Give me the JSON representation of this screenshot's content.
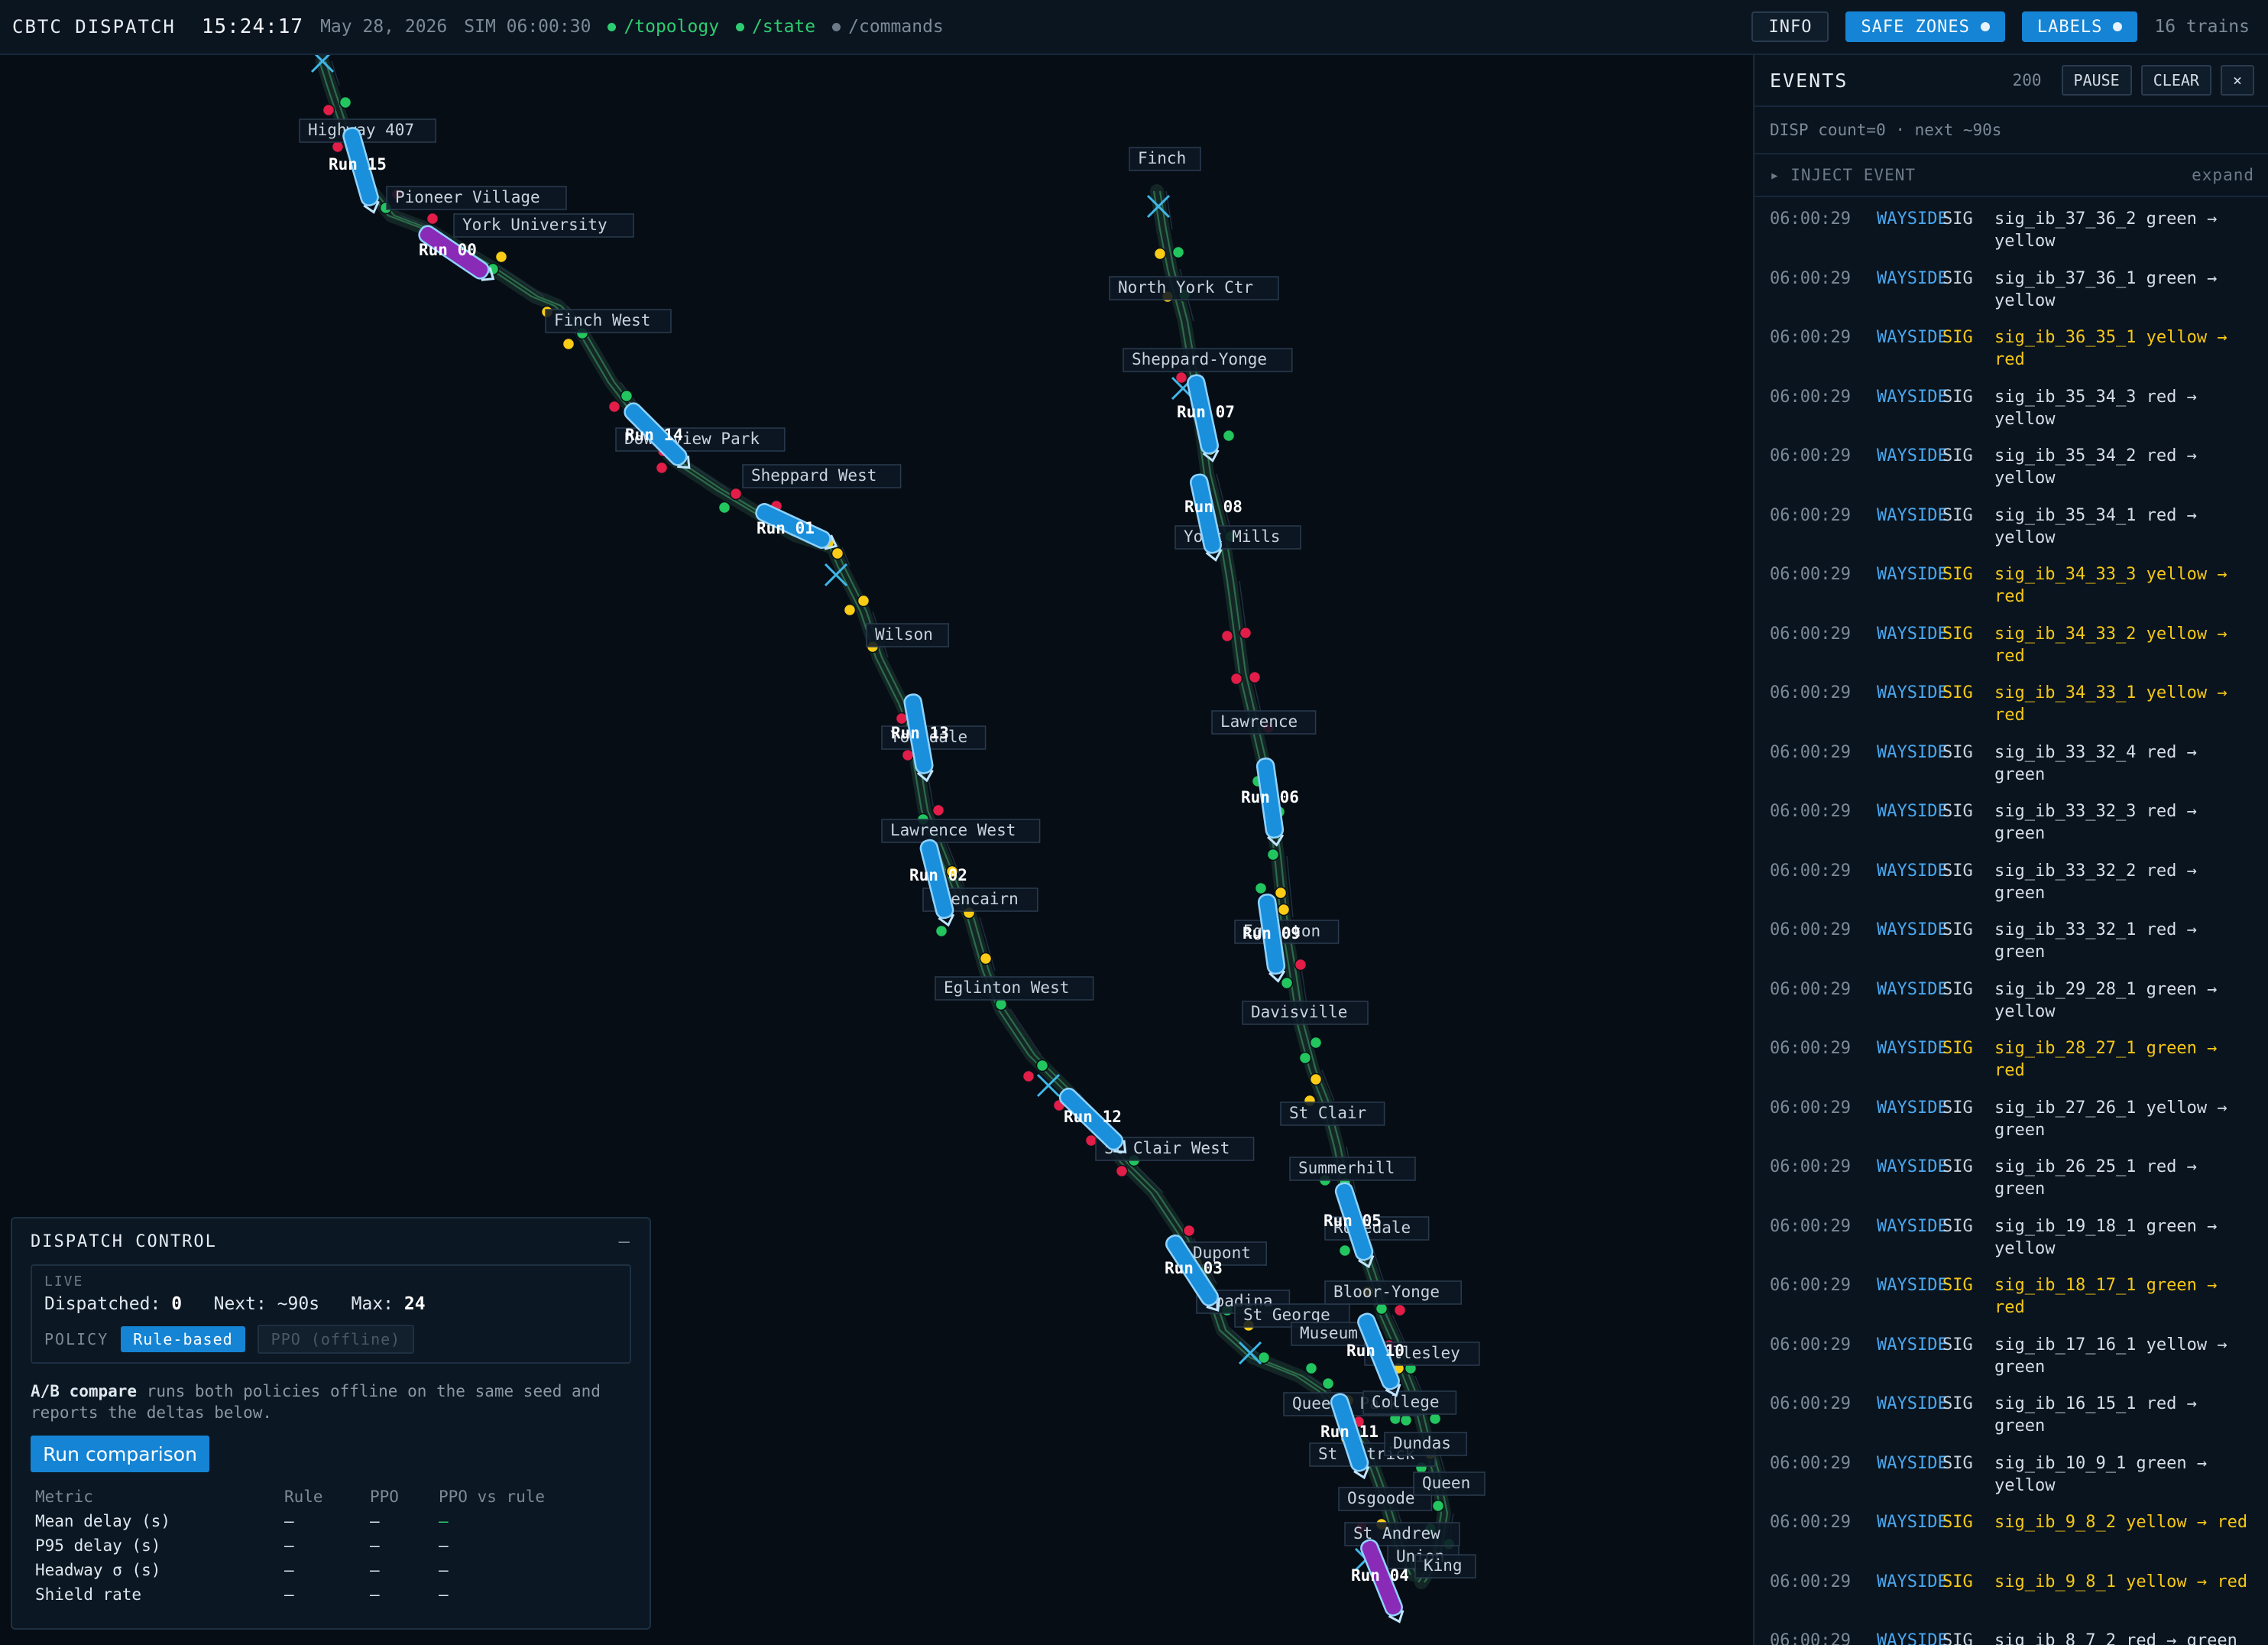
{
  "topbar": {
    "brand": "CBTC DISPATCH",
    "clock": "15:24:17",
    "date": "May 28, 2026",
    "sim": "SIM 06:00:30",
    "streams": [
      {
        "label": "/topology",
        "color": "#2ecc71",
        "text_color": "#2ecc71"
      },
      {
        "label": "/state",
        "color": "#2ecc71",
        "text_color": "#2ecc71"
      },
      {
        "label": "/commands",
        "color": "#6c7a88",
        "text_color": "#7c8a98"
      }
    ],
    "info_label": "INFO",
    "safe_zones_label": "SAFE ZONES",
    "labels_label": "LABELS",
    "train_count": "16 trains"
  },
  "colors": {
    "accent": "#1584d4",
    "train": "#1a8fdc",
    "train_special": "#8a2bb8",
    "signal_green": "#22c55e",
    "signal_yellow": "#facc15",
    "signal_red": "#e11d48",
    "track": "#2d6b4a",
    "highlight": "#f5c818"
  },
  "map": {
    "stations": [
      {
        "label": "Highway 407"
      },
      {
        "label": "Pioneer Village"
      },
      {
        "label": "York University"
      },
      {
        "label": "Finch West"
      },
      {
        "label": "Downsview Park"
      },
      {
        "label": "Sheppard West"
      },
      {
        "label": "Wilson"
      },
      {
        "label": "Yorkdale"
      },
      {
        "label": "Lawrence West"
      },
      {
        "label": "Glencairn"
      },
      {
        "label": "Eglinton West"
      },
      {
        "label": "St Clair West"
      },
      {
        "label": "Dupont"
      },
      {
        "label": "Spadina"
      },
      {
        "label": "St George"
      },
      {
        "label": "Museum"
      },
      {
        "label": "Queens Park"
      },
      {
        "label": "St Patrick"
      },
      {
        "label": "Osgoode"
      },
      {
        "label": "St Andrew"
      },
      {
        "label": "Union"
      },
      {
        "label": "King"
      },
      {
        "label": "Queen"
      },
      {
        "label": "Dundas"
      },
      {
        "label": "College"
      },
      {
        "label": "Wellesley"
      },
      {
        "label": "Bloor-Yonge"
      },
      {
        "label": "Rosedale"
      },
      {
        "label": "Summerhill"
      },
      {
        "label": "St Clair"
      },
      {
        "label": "Davisville"
      },
      {
        "label": "Eglinton"
      },
      {
        "label": "Lawrence"
      },
      {
        "label": "York Mills"
      },
      {
        "label": "Sheppard-Yonge"
      },
      {
        "label": "North York Ctr"
      },
      {
        "label": "Finch"
      }
    ],
    "trains": [
      {
        "label": "Run 15",
        "special": false
      },
      {
        "label": "Run 00",
        "special": true
      },
      {
        "label": "Run 14",
        "special": false
      },
      {
        "label": "Run 01",
        "special": false
      },
      {
        "label": "Run 13",
        "special": false
      },
      {
        "label": "Run 02",
        "special": false
      },
      {
        "label": "Run 12",
        "special": false
      },
      {
        "label": "Run 03",
        "special": false
      },
      {
        "label": "Run 07",
        "special": false
      },
      {
        "label": "Run 08",
        "special": false
      },
      {
        "label": "Run 06",
        "special": false
      },
      {
        "label": "Run 09",
        "special": false
      },
      {
        "label": "Run 05",
        "special": false
      },
      {
        "label": "Run 10",
        "special": false
      },
      {
        "label": "Run 11",
        "special": false
      },
      {
        "label": "Run 04",
        "special": true
      }
    ]
  },
  "events": {
    "title": "EVENTS",
    "count": "200",
    "pause_label": "PAUSE",
    "clear_label": "CLEAR",
    "close_label": "×",
    "subtitle": "DISP count=0 · next ~90s",
    "inject_label": "▸ INJECT EVENT",
    "expand_label": "expand",
    "rows": [
      {
        "time": "06:00:29",
        "source": "WAYSIDE",
        "kind": "SIG",
        "msg": "sig_ib_37_36_2 green → yellow",
        "hl": false
      },
      {
        "time": "06:00:29",
        "source": "WAYSIDE",
        "kind": "SIG",
        "msg": "sig_ib_37_36_1 green → yellow",
        "hl": false
      },
      {
        "time": "06:00:29",
        "source": "WAYSIDE",
        "kind": "SIG",
        "msg": "sig_ib_36_35_1 yellow → red",
        "hl": true
      },
      {
        "time": "06:00:29",
        "source": "WAYSIDE",
        "kind": "SIG",
        "msg": "sig_ib_35_34_3 red → yellow",
        "hl": false
      },
      {
        "time": "06:00:29",
        "source": "WAYSIDE",
        "kind": "SIG",
        "msg": "sig_ib_35_34_2 red → yellow",
        "hl": false
      },
      {
        "time": "06:00:29",
        "source": "WAYSIDE",
        "kind": "SIG",
        "msg": "sig_ib_35_34_1 red → yellow",
        "hl": false
      },
      {
        "time": "06:00:29",
        "source": "WAYSIDE",
        "kind": "SIG",
        "msg": "sig_ib_34_33_3 yellow → red",
        "hl": true
      },
      {
        "time": "06:00:29",
        "source": "WAYSIDE",
        "kind": "SIG",
        "msg": "sig_ib_34_33_2 yellow → red",
        "hl": true
      },
      {
        "time": "06:00:29",
        "source": "WAYSIDE",
        "kind": "SIG",
        "msg": "sig_ib_34_33_1 yellow → red",
        "hl": true
      },
      {
        "time": "06:00:29",
        "source": "WAYSIDE",
        "kind": "SIG",
        "msg": "sig_ib_33_32_4 red → green",
        "hl": false
      },
      {
        "time": "06:00:29",
        "source": "WAYSIDE",
        "kind": "SIG",
        "msg": "sig_ib_33_32_3 red → green",
        "hl": false
      },
      {
        "time": "06:00:29",
        "source": "WAYSIDE",
        "kind": "SIG",
        "msg": "sig_ib_33_32_2 red → green",
        "hl": false
      },
      {
        "time": "06:00:29",
        "source": "WAYSIDE",
        "kind": "SIG",
        "msg": "sig_ib_33_32_1 red → green",
        "hl": false
      },
      {
        "time": "06:00:29",
        "source": "WAYSIDE",
        "kind": "SIG",
        "msg": "sig_ib_29_28_1 green → yellow",
        "hl": false
      },
      {
        "time": "06:00:29",
        "source": "WAYSIDE",
        "kind": "SIG",
        "msg": "sig_ib_28_27_1 green → red",
        "hl": true
      },
      {
        "time": "06:00:29",
        "source": "WAYSIDE",
        "kind": "SIG",
        "msg": "sig_ib_27_26_1 yellow → green",
        "hl": false
      },
      {
        "time": "06:00:29",
        "source": "WAYSIDE",
        "kind": "SIG",
        "msg": "sig_ib_26_25_1 red → green",
        "hl": false
      },
      {
        "time": "06:00:29",
        "source": "WAYSIDE",
        "kind": "SIG",
        "msg": "sig_ib_19_18_1 green → yellow",
        "hl": false
      },
      {
        "time": "06:00:29",
        "source": "WAYSIDE",
        "kind": "SIG",
        "msg": "sig_ib_18_17_1 green → red",
        "hl": true
      },
      {
        "time": "06:00:29",
        "source": "WAYSIDE",
        "kind": "SIG",
        "msg": "sig_ib_17_16_1 yellow → green",
        "hl": false
      },
      {
        "time": "06:00:29",
        "source": "WAYSIDE",
        "kind": "SIG",
        "msg": "sig_ib_16_15_1 red → green",
        "hl": false
      },
      {
        "time": "06:00:29",
        "source": "WAYSIDE",
        "kind": "SIG",
        "msg": "sig_ib_10_9_1 green → yellow",
        "hl": false
      },
      {
        "time": "06:00:29",
        "source": "WAYSIDE",
        "kind": "SIG",
        "msg": "sig_ib_9_8_2 yellow → red",
        "hl": true
      },
      {
        "time": "06:00:29",
        "source": "WAYSIDE",
        "kind": "SIG",
        "msg": "sig_ib_9_8_1 yellow → red",
        "hl": true
      },
      {
        "time": "06:00:29",
        "source": "WAYSIDE",
        "kind": "SIG",
        "msg": "sig_ib_8_7_2 red → green",
        "hl": false
      }
    ]
  },
  "dispatch": {
    "title": "DISPATCH CONTROL",
    "minimize_label": "–",
    "live_label": "LIVE",
    "dispatched_label": "Dispatched:",
    "dispatched_value": "0",
    "next_label": "Next:",
    "next_value": "~90s",
    "max_label": "Max:",
    "max_value": "24",
    "policy_label": "POLICY",
    "policy_active": "Rule-based",
    "policy_inactive": "PPO (offline)",
    "desc_bold": "A/B compare",
    "desc_rest": " runs both policies offline on the same seed and reports the deltas below.",
    "run_button": "Run comparison",
    "table": {
      "headers": [
        "Metric",
        "Rule",
        "PPO",
        "PPO vs rule"
      ],
      "rows": [
        [
          "Mean delay (s)",
          "—",
          "—",
          "—"
        ],
        [
          "P95 delay (s)",
          "—",
          "—",
          "—"
        ],
        [
          "Headway σ (s)",
          "—",
          "—",
          "—"
        ],
        [
          "Shield rate",
          "—",
          "—",
          "—"
        ]
      ]
    }
  }
}
